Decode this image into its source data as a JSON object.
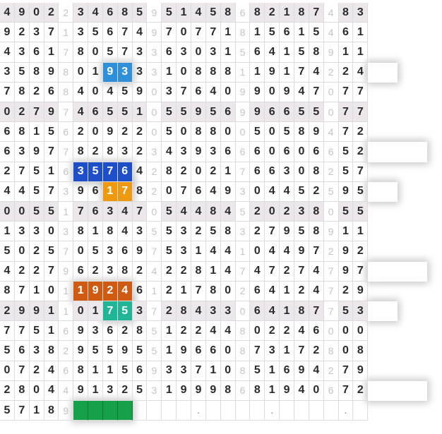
{
  "board": {
    "rows": [
      "4902 2 3468 5 9514 5 8682 1 8748 3",
      "9237 1 3567 4 9707 7 1815 6 1546 1",
      "4361 7 8057 3 3630 3 1564 1 5891 1",
      "3589 8 0193 3 3108 8 8119 1 7422 4",
      "7826 8 4045 9 0376 4 0990 9 4707 7",
      "0279 7 4655 1 0559 5 6996 6 5507 7",
      "6815 6 2092 2 0508 8 0050 5 8947 2",
      "6397 7 8283 2 3439 3 6660 6 0665 2",
      "2751 6 3576 4 2820 2 1766 3 0825 7",
      "4457 3 9617 8 2076 4 9304 4 5259 5",
      "0055 1 7634 7 0544 8 4520 2 3805 5",
      "1330 3 8184 3 5532 5 8327 9 5891 1",
      "5025 7 0536 9 7531 4 4104 4 9729 2",
      "4227 9 6238 2 4228 1 4747 2 7479 7",
      "8710 1 1924 6 1217 8 0264 1 2472 9",
      "2991 1 0175 3 7284 3 3064 1 8775 3",
      "7751 6 9362 8 5122 4 4802 2 4600 0",
      "5638 2 9559 5 5196 6 0873 1 7280 8",
      "0724 6 8115 6 9337 1 0851 6 9427 9",
      "2804 4 9132 5 3199 9 8681 9 4067 2",
      "5718 9 ____ _ ___. _ ___. _ ___. _"
    ],
    "shaded_rows": [
      0,
      5,
      10,
      15
    ],
    "colors": {
      "blue": "#2f8fd8",
      "navy": "#1f4fc8",
      "orange": "#ee9a10",
      "rust": "#cf5a12",
      "teal": "#1fb596",
      "green": "#16a04a",
      "shade": "#ebe7ea"
    },
    "highlights": [
      {
        "row": 3,
        "cols": [
          7,
          8
        ],
        "color": "blue"
      },
      {
        "row": 3,
        "cols": [
          25,
          26
        ],
        "color": "blue"
      },
      {
        "row": 7,
        "cols": [
          25,
          26,
          27,
          28
        ],
        "color": "blue"
      },
      {
        "row": 8,
        "cols": [
          5,
          6,
          7,
          8
        ],
        "color": "navy"
      },
      {
        "row": 9,
        "cols": [
          7,
          8
        ],
        "color": "orange"
      },
      {
        "row": 9,
        "cols": [
          25,
          26
        ],
        "color": "orange"
      },
      {
        "row": 13,
        "cols": [
          25,
          26,
          27,
          28
        ],
        "color": "orange"
      },
      {
        "row": 14,
        "cols": [
          5,
          6,
          7,
          8
        ],
        "color": "rust"
      },
      {
        "row": 15,
        "cols": [
          7,
          8
        ],
        "color": "teal"
      },
      {
        "row": 15,
        "cols": [
          25,
          26
        ],
        "color": "teal"
      },
      {
        "row": 19,
        "cols": [
          25,
          26,
          27,
          28
        ],
        "color": "teal"
      },
      {
        "row": 20,
        "cols": [
          5,
          6,
          7,
          8
        ],
        "color": "green"
      }
    ]
  }
}
